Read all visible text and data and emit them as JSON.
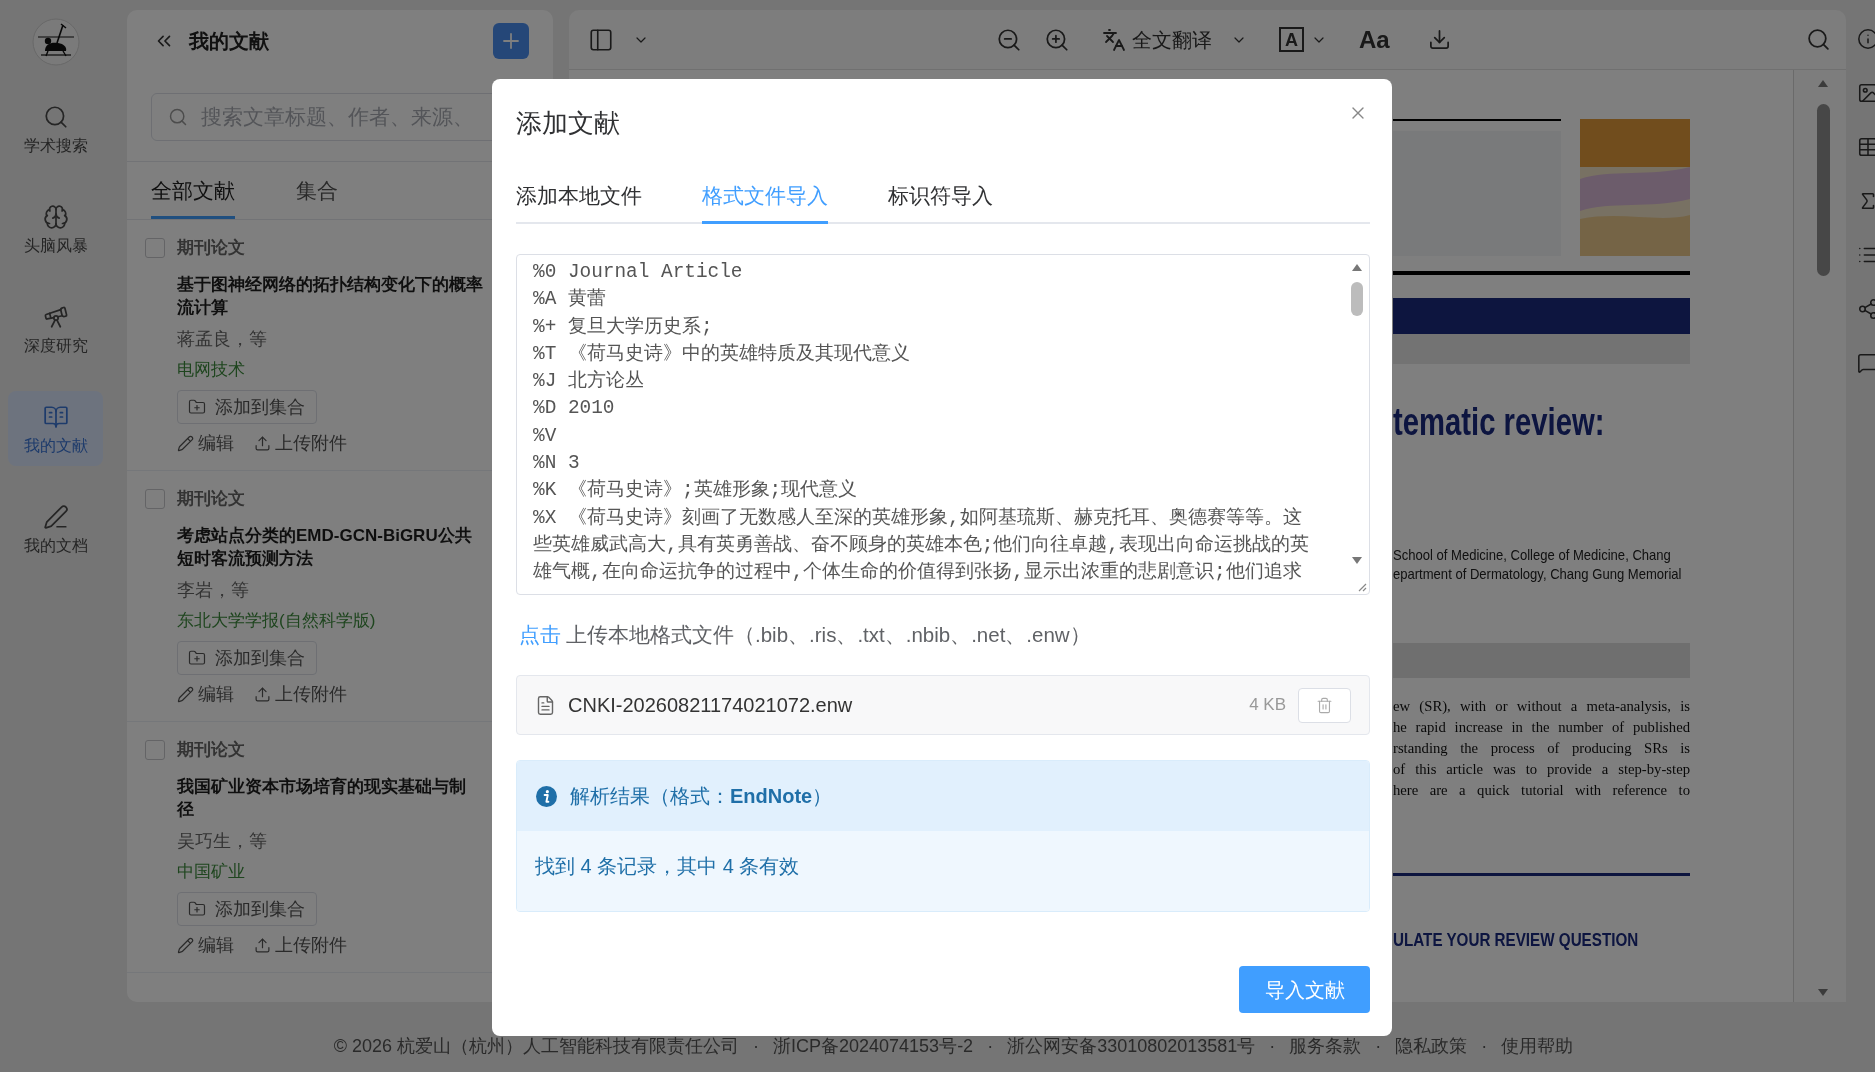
{
  "rail": {
    "items": [
      {
        "kind": "search",
        "label": "学术搜索",
        "selected": false
      },
      {
        "kind": "brain",
        "label": "头脑风暴",
        "selected": false
      },
      {
        "kind": "telescope",
        "label": "深度研究",
        "selected": false
      },
      {
        "kind": "book",
        "label": "我的文献",
        "selected": true
      },
      {
        "kind": "pen",
        "label": "我的文档",
        "selected": false
      }
    ]
  },
  "library": {
    "title": "我的文献",
    "search": {
      "placeholder": "搜索文章标题、作者、来源、"
    },
    "tabs": [
      {
        "label": "全部文献",
        "selected": true
      },
      {
        "label": "集合",
        "selected": false
      }
    ],
    "items": [
      {
        "checked": false,
        "type": "期刊论文",
        "title_lines": [
          "基于图神经网络的拓扑结构变化下的概率",
          "流计算"
        ],
        "authors": "蒋孟良，等",
        "journal": "电网技术",
        "add_button": "添加到集合",
        "actions": [
          {
            "kind": "edit",
            "label": "编辑"
          },
          {
            "kind": "upload",
            "label": "上传附件"
          }
        ]
      },
      {
        "checked": false,
        "type": "期刊论文",
        "title_lines": [
          "考虑站点分类的EMD-GCN-BiGRU公共",
          "短时客流预测方法"
        ],
        "authors": "李岩，等",
        "journal": "东北大学学报(自然科学版)",
        "add_button": "添加到集合",
        "actions": [
          {
            "kind": "edit",
            "label": "编辑"
          },
          {
            "kind": "upload",
            "label": "上传附件"
          }
        ]
      },
      {
        "checked": false,
        "type": "期刊论文",
        "title_lines": [
          "我国矿业资本市场培育的现实基础与制",
          "径"
        ],
        "authors": "吴巧生，等",
        "journal": "中国矿业",
        "add_button": "添加到集合",
        "actions": [
          {
            "kind": "edit",
            "label": "编辑"
          },
          {
            "kind": "upload",
            "label": "上传附件"
          }
        ]
      }
    ]
  },
  "toolbar": {
    "translate": "全文翻译",
    "boxed_letter": "A",
    "letters": "Aa"
  },
  "document": {
    "title": "tematic review:",
    "affiliations": [
      "School of Medicine, College of Medicine, Chang",
      "epartment of Dermatology, Chang Gung Memorial"
    ],
    "abstract_lines": [
      "ew (SR), with or without a meta-analysis, is",
      "he rapid increase in the number of published",
      "rstanding the process of producing SRs is",
      "of this article was to provide a step-by-step",
      "here are a quick tutorial with reference to"
    ],
    "section_heading": "ULATE YOUR REVIEW QUESTION"
  },
  "dialog": {
    "title": "添加文献",
    "tabs": [
      {
        "label": "添加本地文件",
        "selected": false
      },
      {
        "label": "格式文件导入",
        "selected": true
      },
      {
        "label": "标识符导入",
        "selected": false
      }
    ],
    "import_text": {
      "lines": [
        "%0 Journal Article",
        "%A 黄蕾",
        "%+ 复旦大学历史系;",
        "%T 《荷马史诗》中的英雄特质及其现代意义",
        "%J 北方论丛",
        "%D 2010",
        "%V",
        "%N 3",
        "%K 《荷马史诗》;英雄形象;现代意义",
        "%X 《荷马史诗》刻画了无数感人至深的英雄形象,如阿基琉斯、赫克托耳、奥德赛等等。这",
        "些英雄威武高大,具有英勇善战、奋不顾身的英雄本色;他们向往卓越,表现出向命运挑战的英",
        "雄气概,在向命运抗争的过程中,个体生命的价值得到张扬,显示出浓重的悲剧意识;他们追求"
      ]
    },
    "upload_hint": {
      "link": "点击",
      "text": "上传本地格式文件（.bib、.ris、.txt、.nbib、.net、.enw）"
    },
    "file": {
      "name": "CNKI-20260821174021072.enw",
      "size": "4 KB"
    },
    "result": {
      "title": "解析结果（格式：**EndNote**）",
      "message": "找到 4 条记录，其中 4 条有效"
    },
    "submit": "导入文献"
  },
  "footer": {
    "parts": [
      {
        "kind": "text",
        "text": "© 2026 杭爱山（杭州）人工智能科技有限责任公司"
      },
      {
        "kind": "separator",
        "text": "·"
      },
      {
        "kind": "link",
        "text": "浙ICP备2024074153号-2"
      },
      {
        "kind": "separator",
        "text": "·"
      },
      {
        "kind": "link",
        "text": "浙公网安备33010802013581号"
      },
      {
        "kind": "separator",
        "text": "·"
      },
      {
        "kind": "link",
        "text": "服务条款"
      },
      {
        "kind": "separator",
        "text": "·"
      },
      {
        "kind": "link",
        "text": "隐私政策"
      },
      {
        "kind": "separator",
        "text": "·"
      },
      {
        "kind": "link",
        "text": "使用帮助"
      }
    ]
  }
}
